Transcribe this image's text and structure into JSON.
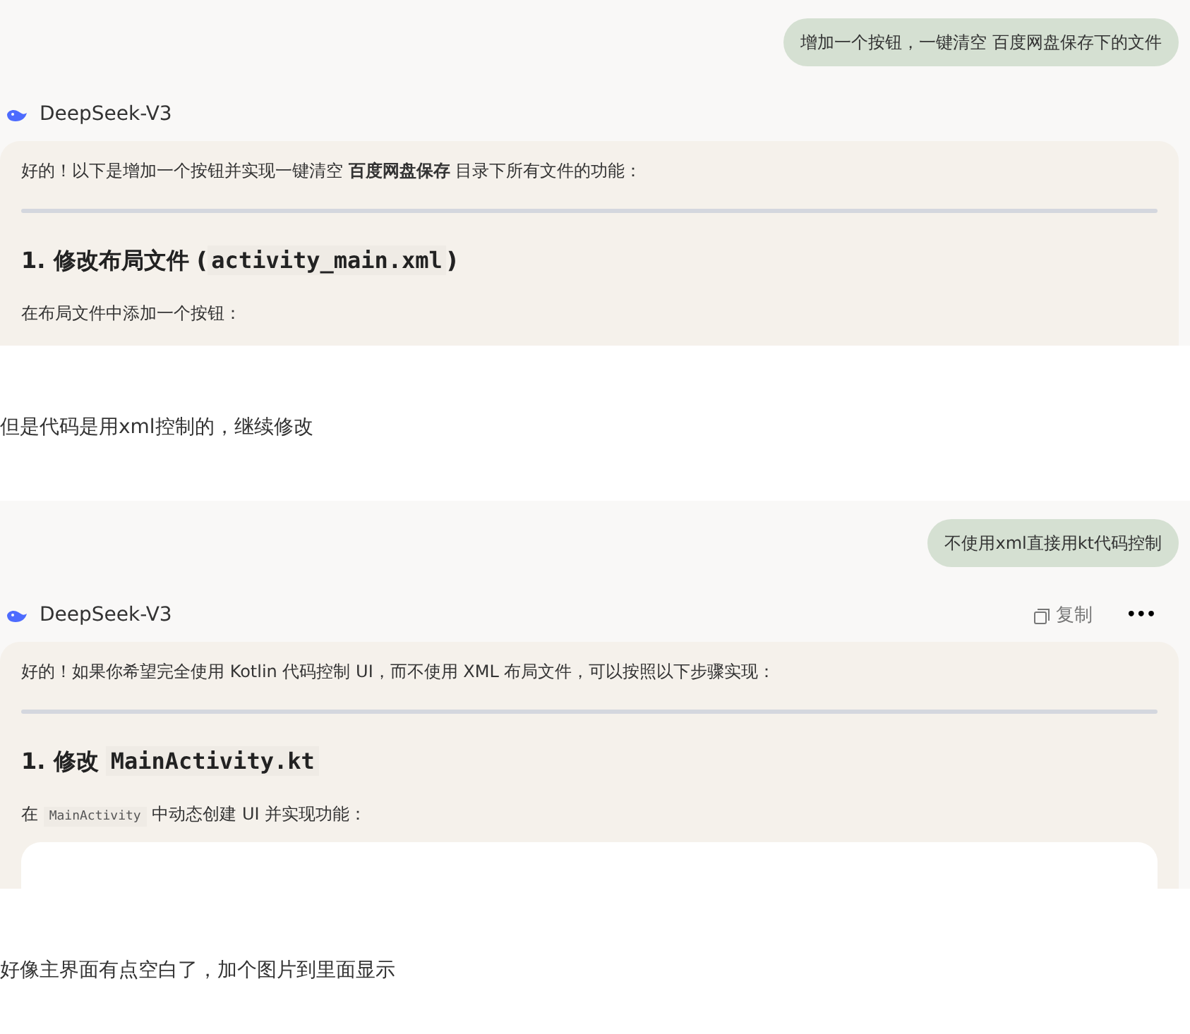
{
  "blocks": [
    {
      "kind": "chat",
      "user_message": "增加一个按钮，一键清空 百度网盘保存下的文件",
      "model": "DeepSeek-V3",
      "intro": "好的！以下是增加一个按钮并实现一键清空 **百度网盘保存** 目录下所有文件的功能：",
      "heading_text": "1. 修改布局文件 (",
      "heading_code": "activity_main.xml",
      "heading_tail": ")",
      "line_pre": "在布局文件中添加一个按钮："
    },
    {
      "kind": "prompt",
      "text": "但是代码是用xml控制的，继续修改"
    },
    {
      "kind": "chat",
      "user_message": "不使用xml直接用kt代码控制",
      "model": "DeepSeek-V3",
      "actions": [
        {
          "kind": "copy",
          "label": "复制"
        },
        {
          "kind": "more",
          "label": "•••"
        }
      ],
      "intro": "好的！如果你希望完全使用 Kotlin 代码控制 UI，而不使用 XML 布局文件，可以按照以下步骤实现：",
      "heading_text": "1. 修改 ",
      "heading_code": "MainActivity.kt",
      "line_pre": "在 ",
      "line_code": "MainActivity",
      "line_post": " 中动态创建 UI 并实现功能：",
      "code_block": true
    },
    {
      "kind": "prompt",
      "text": "好像主界面有点空白了，加个图片到里面显示"
    }
  ]
}
